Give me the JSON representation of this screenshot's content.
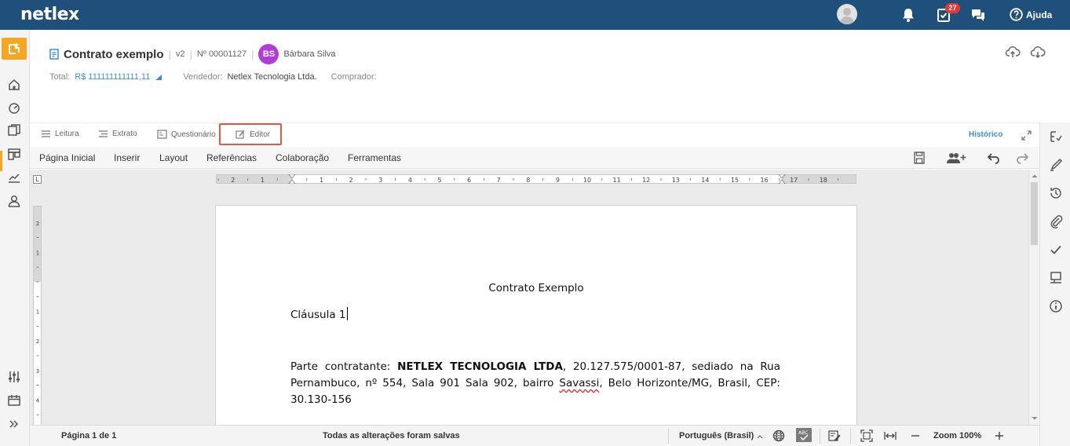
{
  "app": {
    "logo": "netlex",
    "notifications_count": "27",
    "help_label": "Ajuda"
  },
  "document": {
    "title": "Contrato exemplo",
    "version": "v2",
    "number": "Nº 00001127",
    "owner_initials": "BS",
    "owner_name": "Bárbara Silva",
    "total_label": "Total:",
    "total_value": "R$ 111111111111,11",
    "seller_label": "Vendedor:",
    "seller_value": "Netlex Tecnologia Ltda.",
    "buyer_label": "Comprador:"
  },
  "view_tabs": [
    {
      "label": "Leitura"
    },
    {
      "label": "Extrato"
    },
    {
      "label": "Questionário"
    },
    {
      "label": "Editor"
    }
  ],
  "history_label": "Histórico",
  "ribbon": {
    "menus": [
      "Página Inicial",
      "Inserir",
      "Layout",
      "Referências",
      "Colaboração",
      "Ferramentas"
    ]
  },
  "ruler": {
    "corner": "L",
    "labels": [
      "2",
      "1",
      "1",
      "2",
      "3",
      "4",
      "5",
      "6",
      "7",
      "8",
      "9",
      "10",
      "11",
      "12",
      "13",
      "14",
      "15",
      "16",
      "17",
      "18"
    ]
  },
  "page": {
    "heading": "Contrato Exemplo",
    "clause": "Cláusula 1",
    "para_prefix": "Parte contratante: ",
    "para_company": "NETLEX TECNOLOGIA LTDA",
    "para_part1": ", 20.127.575/0001-87, sediado na Rua Pernambuco, nº 554, Sala 901 Sala 902, bairro ",
    "para_misspelled": "Savassi",
    "para_part2": ", Belo Horizonte/MG, Brasil, CEP: 30.130-156"
  },
  "status": {
    "page_info": "Página 1 de 1",
    "save_state": "Todas as alterações foram salvas",
    "language": "Português (Brasil)",
    "zoom": "Zoom 100%"
  },
  "colors": {
    "topbar": "#1f4f7b",
    "accent": "#f5a623",
    "highlight_border": "#e05a43",
    "link": "#3a8fd6",
    "avatar": "#b23cd8"
  }
}
